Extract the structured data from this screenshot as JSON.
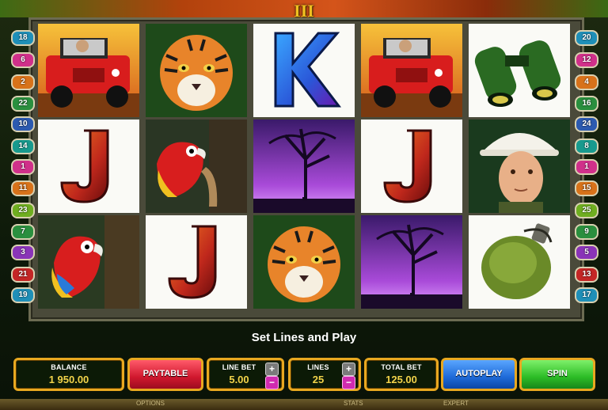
{
  "game": {
    "title_numeral": "III"
  },
  "paylines": {
    "left": [
      "18",
      "6",
      "2",
      "22",
      "10",
      "14",
      "1",
      "11",
      "23",
      "7",
      "3",
      "21",
      "19"
    ],
    "right": [
      "20",
      "12",
      "4",
      "16",
      "24",
      "8",
      "1",
      "15",
      "25",
      "9",
      "5",
      "13",
      "17"
    ]
  },
  "reels": [
    [
      "jeep",
      "letter-j",
      "parrot"
    ],
    [
      "tiger",
      "parrot",
      "letter-j"
    ],
    [
      "letter-k",
      "savanna-tree",
      "tiger"
    ],
    [
      "jeep",
      "letter-j",
      "savanna-tree"
    ],
    [
      "binoculars",
      "explorer",
      "canteen"
    ]
  ],
  "symbol_letters": {
    "k": "K",
    "j": "J"
  },
  "message": "Set Lines and Play",
  "balance": {
    "label": "BALANCE",
    "value": "1 950.00"
  },
  "paytable": {
    "label": "PAYTABLE"
  },
  "line_bet": {
    "label": "LINE BET",
    "value": "5.00"
  },
  "lines": {
    "label": "LINES",
    "value": "25"
  },
  "total_bet": {
    "label": "TOTAL BET",
    "value": "125.00"
  },
  "autoplay": {
    "label": "AUTOPLAY"
  },
  "spin": {
    "label": "SPIN"
  },
  "stepper": {
    "plus": "+",
    "minus": "−"
  },
  "bottom_menu": [
    "OPTIONS",
    "STATS",
    "EXPERT"
  ],
  "colors": {
    "frame_gold": "#e8a820",
    "value_yellow": "#f2d34a"
  }
}
